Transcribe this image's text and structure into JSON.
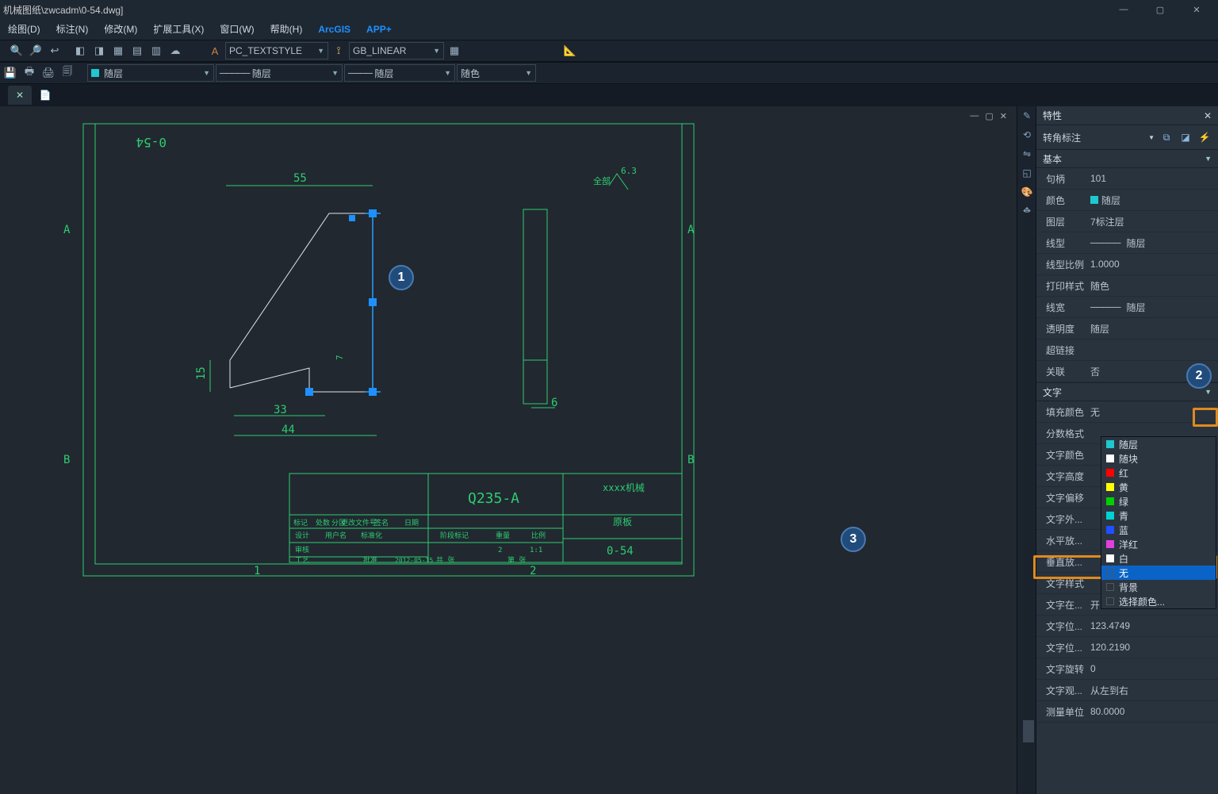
{
  "title": "机械图纸\\zwcadm\\0-54.dwg]",
  "window_buttons": {
    "min": "—",
    "max": "▢",
    "close": "✕"
  },
  "menu": [
    "绘图(D)",
    "标注(N)",
    "修改(M)",
    "扩展工具(X)",
    "窗口(W)",
    "帮助(H)",
    "ArcGIS",
    "APP+"
  ],
  "toolbar1": {
    "textstyle": "PC_TEXTSTYLE",
    "dimstyle": "GB_LINEAR"
  },
  "toolbar2": {
    "layer_combo1": "随层",
    "layer_combo2": "随层",
    "layer_combo3": "随层",
    "color_combo": "随色"
  },
  "doctab": {
    "close": "✕",
    "add": "+"
  },
  "canvas_ctrl": {
    "min": "—",
    "max": "▢",
    "close": "✕"
  },
  "drawing": {
    "title_rot": "0-54",
    "dim_top": "55",
    "dim_left": "15",
    "dim_tiny": "7",
    "dim_bot1": "33",
    "dim_bot2": "44",
    "dim_r": "6",
    "surf_val": "6.3",
    "surf_txt": "全部",
    "label_A1": "A",
    "label_A2": "A",
    "label_B1": "B",
    "label_B2": "B",
    "arr_1": "1",
    "arr_2": "2",
    "tb_material": "Q235-A",
    "tb_company": "xxxx机械",
    "tb_name": "原板",
    "tb_partno": "0-54",
    "tb_dz": "标记",
    "tb_sl": "处数",
    "tb_fq": "分区",
    "tb_gh": "更改文件号",
    "tb_qq": "签名",
    "tb_rq": "日期",
    "tb_sj": "设计",
    "tb_sjv": "用户名",
    "tb_bz": "标准化",
    "tb_jd": "阶段标记",
    "tb_zl": "重量",
    "tb_bl": "比例",
    "tb_sc": "审核",
    "tb_bl_v": "1:1",
    "tb_zl_v": "2",
    "tb_gy": "工艺",
    "tb_pz": "批准",
    "tb_date": "2012-05-15",
    "tb_sheet": "共  张",
    "tb_page": "第  张"
  },
  "annotations": {
    "c1": "1",
    "c2": "2",
    "c3": "3"
  },
  "properties": {
    "panel_title": "特性",
    "obj_type": "转角标注",
    "section_basic": "基本",
    "rows_basic": [
      {
        "label": "句柄",
        "value": "101"
      },
      {
        "label": "颜色",
        "value": "随层",
        "sw": "#1fc7cf"
      },
      {
        "label": "图层",
        "value": "7标注层"
      },
      {
        "label": "线型",
        "value": "随层",
        "linetype": true
      },
      {
        "label": "线型比例",
        "value": "1.0000"
      },
      {
        "label": "打印样式",
        "value": "随色"
      },
      {
        "label": "线宽",
        "value": "随层",
        "linetype": true
      },
      {
        "label": "透明度",
        "value": "随层"
      },
      {
        "label": "超链接",
        "value": ""
      },
      {
        "label": "关联",
        "value": "否"
      }
    ],
    "section_text": "文字",
    "rows_text": [
      {
        "label": "填充颜色",
        "value": "无"
      },
      {
        "label": "分数格式",
        "value": ""
      },
      {
        "label": "文字颜色",
        "value": ""
      },
      {
        "label": "文字高度",
        "value": ""
      },
      {
        "label": "文字偏移",
        "value": ""
      },
      {
        "label": "文字外...",
        "value": ""
      },
      {
        "label": "水平放...",
        "value": ""
      },
      {
        "label": "垂直放...",
        "value": ""
      },
      {
        "label": "文字样式",
        "value": ""
      },
      {
        "label": "文字在...",
        "value": "开"
      },
      {
        "label": "文字位...",
        "value": "123.4749"
      },
      {
        "label": "文字位...",
        "value": "120.2190"
      },
      {
        "label": "文字旋转",
        "value": "0"
      },
      {
        "label": "文字观...",
        "value": "从左到右"
      },
      {
        "label": "测量单位",
        "value": "80.0000"
      }
    ],
    "dropdown": [
      {
        "txt": "随层",
        "sw": "#1fc7cf"
      },
      {
        "txt": "随块",
        "sw": "#ffffff"
      },
      {
        "txt": "红",
        "sw": "#ff0000"
      },
      {
        "txt": "黄",
        "sw": "#ffff00"
      },
      {
        "txt": "绿",
        "sw": "#00d000"
      },
      {
        "txt": "青",
        "sw": "#00d0d0"
      },
      {
        "txt": "蓝",
        "sw": "#2050ff"
      },
      {
        "txt": "洋红",
        "sw": "#e040e0"
      },
      {
        "txt": "白",
        "sw": "#ffffff"
      },
      {
        "txt": "无",
        "sw": "",
        "sel": true
      },
      {
        "txt": "背景",
        "sw": ""
      },
      {
        "txt": "选择颜色...",
        "sw": ""
      }
    ]
  }
}
